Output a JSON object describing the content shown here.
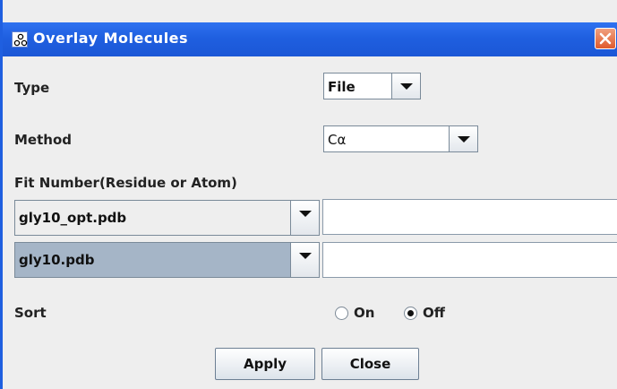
{
  "window": {
    "title": "Overlay Molecules"
  },
  "type": {
    "label": "Type",
    "value": "File"
  },
  "method": {
    "label": "Method",
    "value": "Cα"
  },
  "fit": {
    "label": "Fit Number(Residue or Atom)",
    "rows": [
      {
        "file": "gly10_opt.pdb",
        "input": ""
      },
      {
        "file": "gly10.pdb",
        "input": ""
      }
    ]
  },
  "sort": {
    "label": "Sort",
    "on_label": "On",
    "off_label": "Off",
    "selected": "Off"
  },
  "buttons": {
    "apply": "Apply",
    "close": "Close"
  },
  "colors": {
    "titlebar": "#1f5fe0",
    "close_button": "#e05a2c",
    "selected_combo": "#a5b5c7"
  }
}
